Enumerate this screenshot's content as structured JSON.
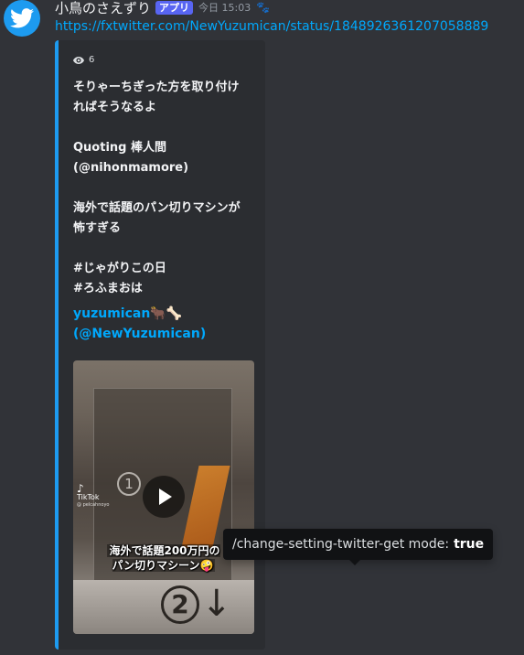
{
  "message": {
    "username": "小鳥のさえずり",
    "app_badge": "アプリ",
    "timestamp": "今日 15:03",
    "link": "https://fxtwitter.com/NewYuzumican/status/1848926361207058889"
  },
  "embed": {
    "accent_color": "#1d9bf0",
    "views": "6",
    "description": "そりゃーちぎった方を取り付け\nればそうなるよ\n\nQuoting 棒人間\n(@nihonmamore)\n\n海外で話題のパン切りマシンが\n怖すぎる\n\n#じゃがりこの日\n#ろふまおは",
    "author": "yuzumican🐂🦴\n(@NewYuzumican)",
    "video": {
      "tiktok_label": "TikTok",
      "tiktok_handle": "@ pelcahnoyo",
      "caption": "海外で話題200万円の\nパン切りマシーン🤪",
      "num1": "1",
      "num2": "2",
      "arrow": "↓"
    }
  },
  "tooltip": {
    "command": "/change-setting-twitter-get mode:",
    "value": "true"
  }
}
